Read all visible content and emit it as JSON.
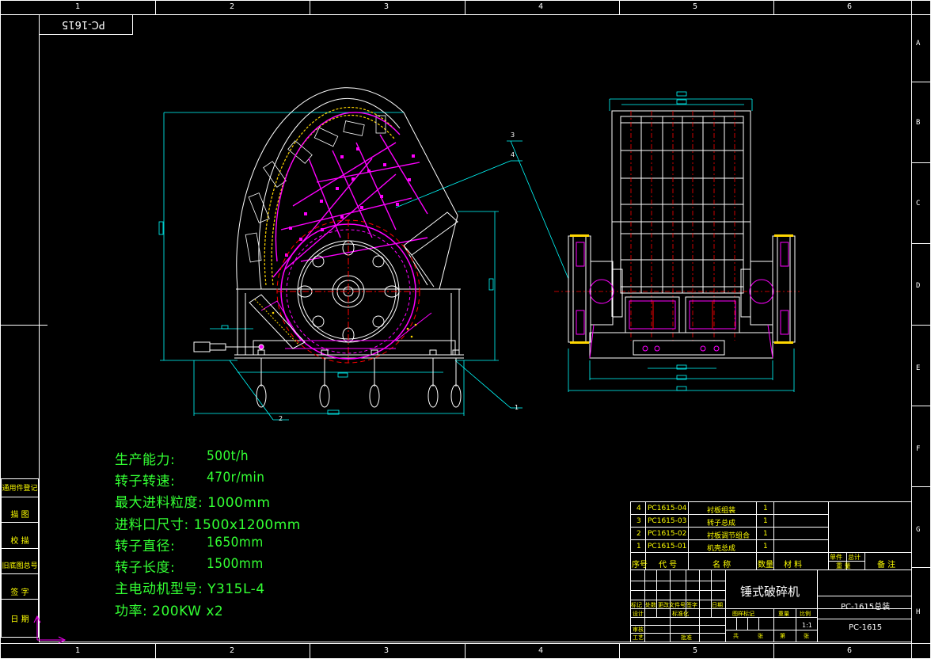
{
  "drawing_code_mirrored": "PC-1615",
  "column_numbers": [
    "1",
    "2",
    "3",
    "4",
    "5",
    "6"
  ],
  "row_letters": [
    "A",
    "B",
    "C",
    "D",
    "E",
    "F",
    "G",
    "H"
  ],
  "balloons": [
    "1",
    "2",
    "3",
    "4"
  ],
  "specs": [
    {
      "label": "生产能力:",
      "value": "500t/h"
    },
    {
      "label": "转子转速:",
      "value": "470r/min"
    },
    {
      "label": "最大进料粒度:",
      "value": "1000mm"
    },
    {
      "label": "进料口尺寸:",
      "value": "1500x1200mm"
    },
    {
      "label": "转子直径:",
      "value": "1650mm"
    },
    {
      "label": "转子长度:",
      "value": "1500mm"
    },
    {
      "label": "主电动机型号:",
      "value": "Y315L-4"
    },
    {
      "label": "功率:",
      "value": "200KW x2"
    }
  ],
  "side_labels": [
    "通用件登记",
    "描 图",
    "校 描",
    "旧底图总号",
    "签 字",
    "日 期"
  ],
  "parts_list": [
    {
      "no": "4",
      "code": "PC1615-04",
      "name": "衬板组装",
      "qty": "1"
    },
    {
      "no": "3",
      "code": "PC1615-03",
      "name": "转子总成",
      "qty": "1"
    },
    {
      "no": "2",
      "code": "PC1615-02",
      "name": "衬板调节组合",
      "qty": "1"
    },
    {
      "no": "1",
      "code": "PC1615-01",
      "name": "机壳总成",
      "qty": "1"
    }
  ],
  "parts_header": {
    "no": "序号",
    "code": "代 号",
    "name": "名 称",
    "qty": "数量",
    "material": "材 料",
    "unit_weight": "单件",
    "total_weight": "总计",
    "weight": "重 量",
    "note": "备 注"
  },
  "title_block": {
    "product_name": "锤式破碎机",
    "drawing_title": "PC-1615总装",
    "drawing_code": "PC-1615",
    "scale": "1:1",
    "row_labels": [
      "标记",
      "处数",
      "更改文件号",
      "签字",
      "日期"
    ],
    "roles": [
      "设计",
      "标准化",
      "审核",
      "工艺",
      "批准"
    ],
    "stage_labels": [
      "图样标记",
      "重量",
      "比例"
    ],
    "sheet_labels": [
      "共",
      "张",
      "第",
      "张"
    ]
  },
  "colors": {
    "frame": "#ffffff",
    "outline": "#ffffff",
    "dimension": "#00ffff",
    "rotor": "#ff00ff",
    "liner": "#ffff00",
    "center": "#ff0000",
    "hatch": "#ffd700",
    "spec_text": "#33ff33",
    "title_text": "#ffff00",
    "ucs": "#ff00ff"
  }
}
